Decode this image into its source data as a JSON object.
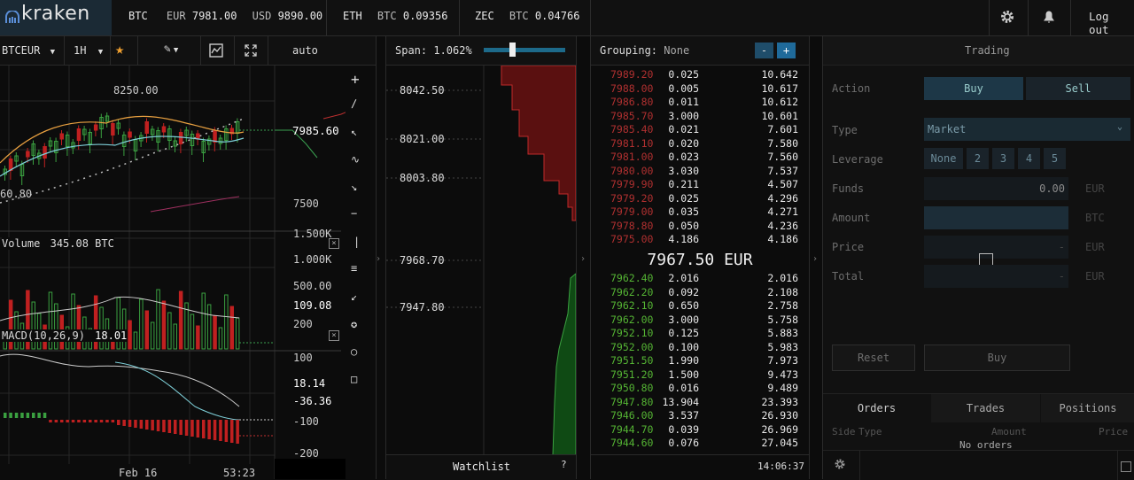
{
  "brand": {
    "logo_text": "kraken"
  },
  "ticker": [
    {
      "sym": "BTC",
      "pair1": "EUR",
      "v1": "7981.00",
      "pair2": "USD",
      "v2": "9890.00"
    },
    {
      "sym": "ETH",
      "pair1": "BTC",
      "v1": "0.09356"
    },
    {
      "sym": "ZEC",
      "pair1": "BTC",
      "v1": "0.04766"
    }
  ],
  "header": {
    "logout": "Log out"
  },
  "chart": {
    "pair": "BTCEUR",
    "interval": "1H",
    "scale_mode": "auto",
    "price_labels": [
      "7985.60",
      "7500"
    ],
    "high_label": "8250.00",
    "low_label": "60.80",
    "volume_label": "Volume",
    "volume_value": "345.08 BTC",
    "volume_axis": [
      "1.500K",
      "1.000K",
      "500.00",
      "109.08"
    ],
    "macd_label": "MACD(10,26,9)",
    "macd_value": "18.01",
    "macd_axis": [
      "200",
      "100",
      "18.14",
      "-36.36",
      "-100",
      "-200"
    ],
    "date_label": "Feb 16",
    "time_label": "53:23"
  },
  "depth": {
    "span_label": "Span:",
    "span_value": "1.062%",
    "axis": [
      "8042.50",
      "8021.00",
      "8003.80",
      "7968.70",
      "7947.80"
    ],
    "watchlist": "Watchlist",
    "help": "?"
  },
  "orderbook": {
    "grouping_label": "Grouping:",
    "grouping_value": "None",
    "minus": "-",
    "plus": "+",
    "asks": [
      [
        "7989.20",
        "0.025",
        "10.642"
      ],
      [
        "7988.00",
        "0.005",
        "10.617"
      ],
      [
        "7986.80",
        "0.011",
        "10.612"
      ],
      [
        "7985.70",
        "3.000",
        "10.601"
      ],
      [
        "7985.40",
        "0.021",
        "7.601"
      ],
      [
        "7981.10",
        "0.020",
        "7.580"
      ],
      [
        "7981.00",
        "0.023",
        "7.560"
      ],
      [
        "7980.00",
        "3.030",
        "7.537"
      ],
      [
        "7979.90",
        "0.211",
        "4.507"
      ],
      [
        "7979.20",
        "0.025",
        "4.296"
      ],
      [
        "7979.00",
        "0.035",
        "4.271"
      ],
      [
        "7978.80",
        "0.050",
        "4.236"
      ],
      [
        "7975.00",
        "4.186",
        "4.186"
      ]
    ],
    "mid": "7967.50 EUR",
    "bids": [
      [
        "7962.40",
        "2.016",
        "2.016"
      ],
      [
        "7962.20",
        "0.092",
        "2.108"
      ],
      [
        "7962.10",
        "0.650",
        "2.758"
      ],
      [
        "7962.00",
        "3.000",
        "5.758"
      ],
      [
        "7952.10",
        "0.125",
        "5.883"
      ],
      [
        "7952.00",
        "0.100",
        "5.983"
      ],
      [
        "7951.50",
        "1.990",
        "7.973"
      ],
      [
        "7951.20",
        "1.500",
        "9.473"
      ],
      [
        "7950.80",
        "0.016",
        "9.489"
      ],
      [
        "7947.80",
        "13.904",
        "23.393"
      ],
      [
        "7946.00",
        "3.537",
        "26.930"
      ],
      [
        "7944.70",
        "0.039",
        "26.969"
      ],
      [
        "7944.60",
        "0.076",
        "27.045"
      ]
    ],
    "time": "14:06:37"
  },
  "trading": {
    "title": "Trading",
    "action_label": "Action",
    "buy": "Buy",
    "sell": "Sell",
    "type_label": "Type",
    "type_value": "Market",
    "leverage_label": "Leverage",
    "leverage_options": [
      "None",
      "2",
      "3",
      "4",
      "5"
    ],
    "funds_label": "Funds",
    "funds_value": "0.00",
    "funds_unit": "EUR",
    "amount_label": "Amount",
    "amount_unit": "BTC",
    "price_label": "Price",
    "price_value": "-",
    "price_unit": "EUR",
    "total_label": "Total",
    "total_value": "-",
    "total_unit": "EUR",
    "reset": "Reset",
    "buy_submit": "Buy",
    "tabs": [
      "Orders",
      "Trades",
      "Positions"
    ],
    "cols": [
      "Side",
      "Type",
      "Amount",
      "Price"
    ],
    "empty": "No orders"
  }
}
